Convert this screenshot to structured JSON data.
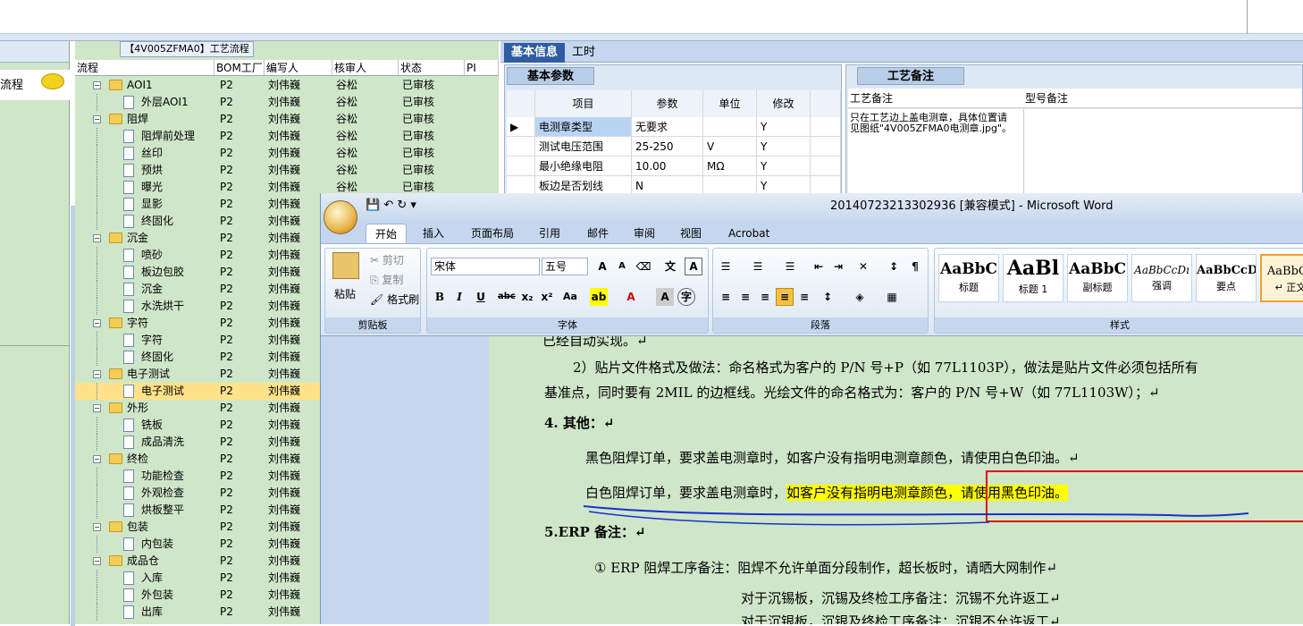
{
  "left_pane": {
    "item": "流程"
  },
  "tree": {
    "title": "【4V005ZFMA0】工艺流程",
    "headers": [
      "流程",
      "BOM工厂",
      "编写人",
      "核审人",
      "状态",
      "PI"
    ],
    "rows": [
      {
        "label": "AOI1",
        "level": 0,
        "folder": true,
        "bom": "P2",
        "writer": "刘伟巍",
        "reviewer": "谷松",
        "status": "已审核"
      },
      {
        "label": "外层AOI1",
        "level": 1,
        "folder": false,
        "bom": "P2",
        "writer": "刘伟巍",
        "reviewer": "谷松",
        "status": "已审核"
      },
      {
        "label": "阻焊",
        "level": 0,
        "folder": true,
        "bom": "P2",
        "writer": "刘伟巍",
        "reviewer": "谷松",
        "status": "已审核"
      },
      {
        "label": "阻焊前处理",
        "level": 1,
        "folder": false,
        "bom": "P2",
        "writer": "刘伟巍",
        "reviewer": "谷松",
        "status": "已审核"
      },
      {
        "label": "丝印",
        "level": 1,
        "folder": false,
        "bom": "P2",
        "writer": "刘伟巍",
        "reviewer": "谷松",
        "status": "已审核"
      },
      {
        "label": "预烘",
        "level": 1,
        "folder": false,
        "bom": "P2",
        "writer": "刘伟巍",
        "reviewer": "谷松",
        "status": "已审核"
      },
      {
        "label": "曝光",
        "level": 1,
        "folder": false,
        "bom": "P2",
        "writer": "刘伟巍",
        "reviewer": "谷松",
        "status": "已审核"
      },
      {
        "label": "显影",
        "level": 1,
        "folder": false,
        "bom": "P2",
        "writer": "刘伟巍",
        "reviewer": "",
        "status": ""
      },
      {
        "label": "终固化",
        "level": 1,
        "folder": false,
        "bom": "P2",
        "writer": "刘伟巍",
        "reviewer": "",
        "status": ""
      },
      {
        "label": "沉金",
        "level": 0,
        "folder": true,
        "bom": "P2",
        "writer": "刘伟巍",
        "reviewer": "",
        "status": ""
      },
      {
        "label": "喷砂",
        "level": 1,
        "folder": false,
        "bom": "P2",
        "writer": "刘伟巍",
        "reviewer": "",
        "status": ""
      },
      {
        "label": "板边包胶",
        "level": 1,
        "folder": false,
        "bom": "P2",
        "writer": "刘伟巍",
        "reviewer": "",
        "status": ""
      },
      {
        "label": "沉金",
        "level": 1,
        "folder": false,
        "bom": "P2",
        "writer": "刘伟巍",
        "reviewer": "",
        "status": ""
      },
      {
        "label": "水洗烘干",
        "level": 1,
        "folder": false,
        "bom": "P2",
        "writer": "刘伟巍",
        "reviewer": "",
        "status": ""
      },
      {
        "label": "字符",
        "level": 0,
        "folder": true,
        "bom": "P2",
        "writer": "刘伟巍",
        "reviewer": "",
        "status": ""
      },
      {
        "label": "字符",
        "level": 1,
        "folder": false,
        "bom": "P2",
        "writer": "刘伟巍",
        "reviewer": "",
        "status": ""
      },
      {
        "label": "终固化",
        "level": 1,
        "folder": false,
        "bom": "P2",
        "writer": "刘伟巍",
        "reviewer": "",
        "status": ""
      },
      {
        "label": "电子测试",
        "level": 0,
        "folder": true,
        "bom": "P2",
        "writer": "刘伟巍",
        "reviewer": "",
        "status": ""
      },
      {
        "label": "电子测试",
        "level": 1,
        "folder": false,
        "bom": "P2",
        "writer": "刘伟巍",
        "reviewer": "",
        "status": "",
        "selected": true
      },
      {
        "label": "外形",
        "level": 0,
        "folder": true,
        "bom": "P2",
        "writer": "刘伟巍",
        "reviewer": "",
        "status": ""
      },
      {
        "label": "铣板",
        "level": 1,
        "folder": false,
        "bom": "P2",
        "writer": "刘伟巍",
        "reviewer": "",
        "status": ""
      },
      {
        "label": "成品清洗",
        "level": 1,
        "folder": false,
        "bom": "P2",
        "writer": "刘伟巍",
        "reviewer": "",
        "status": ""
      },
      {
        "label": "终检",
        "level": 0,
        "folder": true,
        "bom": "P2",
        "writer": "刘伟巍",
        "reviewer": "",
        "status": ""
      },
      {
        "label": "功能检查",
        "level": 1,
        "folder": false,
        "bom": "P2",
        "writer": "刘伟巍",
        "reviewer": "",
        "status": ""
      },
      {
        "label": "外观检查",
        "level": 1,
        "folder": false,
        "bom": "P2",
        "writer": "刘伟巍",
        "reviewer": "",
        "status": ""
      },
      {
        "label": "烘板整平",
        "level": 1,
        "folder": false,
        "bom": "P2",
        "writer": "刘伟巍",
        "reviewer": "",
        "status": ""
      },
      {
        "label": "包装",
        "level": 0,
        "folder": true,
        "bom": "P2",
        "writer": "刘伟巍",
        "reviewer": "",
        "status": ""
      },
      {
        "label": "内包装",
        "level": 1,
        "folder": false,
        "bom": "P2",
        "writer": "刘伟巍",
        "reviewer": "",
        "status": ""
      },
      {
        "label": "成品仓",
        "level": 0,
        "folder": true,
        "bom": "P2",
        "writer": "刘伟巍",
        "reviewer": "",
        "status": ""
      },
      {
        "label": "入库",
        "level": 1,
        "folder": false,
        "bom": "P2",
        "writer": "刘伟巍",
        "reviewer": "",
        "status": ""
      },
      {
        "label": "外包装",
        "level": 1,
        "folder": false,
        "bom": "P2",
        "writer": "刘伟巍",
        "reviewer": "",
        "status": ""
      },
      {
        "label": "出库",
        "level": 1,
        "folder": false,
        "bom": "P2",
        "writer": "刘伟巍",
        "reviewer": "",
        "status": ""
      }
    ]
  },
  "right_tabs": [
    "基本信息",
    "工时"
  ],
  "basic_params": {
    "title": "基本参数",
    "headers": [
      "项目",
      "参数",
      "单位",
      "修改"
    ],
    "rows": [
      {
        "item": "电测章类型",
        "param": "无要求",
        "unit": "",
        "edit": "Y",
        "current": true
      },
      {
        "item": "测试电压范围",
        "param": "25-250",
        "unit": "V",
        "edit": "Y"
      },
      {
        "item": "最小绝缘电阻",
        "param": "10.00",
        "unit": "MΩ",
        "edit": "Y"
      },
      {
        "item": "板边是否划线",
        "param": "N",
        "unit": "",
        "edit": "Y"
      }
    ]
  },
  "craft_note": {
    "title": "工艺备注",
    "col1": "工艺备注",
    "col2": "型号备注",
    "text": "只在工艺边上盖电测章，具体位置请见图纸\"4V005ZFMA0电测章.jpg\"。"
  },
  "word": {
    "title": "20140723213302936 [兼容模式] - Microsoft Word",
    "tabs": [
      "开始",
      "插入",
      "页面布局",
      "引用",
      "邮件",
      "审阅",
      "视图",
      "Acrobat"
    ],
    "clipboard": {
      "paste": "粘贴",
      "cut": "剪切",
      "copy": "复制",
      "format_painter": "格式刷",
      "label": "剪贴板"
    },
    "font": {
      "name": "宋体",
      "size": "五号",
      "label": "字体"
    },
    "paragraph_label": "段落",
    "styles": [
      {
        "preview": "AaBbC",
        "name": "标题"
      },
      {
        "preview": "AaBl",
        "name": "标题 1"
      },
      {
        "preview": "AaBbC",
        "name": "副标题"
      },
      {
        "preview": "AaBbCcDı",
        "name": "强调"
      },
      {
        "preview": "AaBbCcD",
        "name": "要点"
      },
      {
        "preview": "AaBbCc",
        "name": "↵ 正文"
      }
    ],
    "styles_label": "样式",
    "doc": {
      "line0": "已经自动实现。↵",
      "line1": "2）贴片文件格式及做法：命名格式为客户的 P/N 号+P（如 77L1103P），做法是贴片文件必须包括所有",
      "line2": "基准点，同时要有 2MIL 的边框线。光绘文件的命名格式为：客户的  P/N 号+W（如 77L1103W）；↵",
      "line3": "4. 其他：↵",
      "line4": "黑色阻焊订单，要求盖电测章时，如客户没有指明电测章颜色，请使用白色印油。↵",
      "line5a": "白色阻焊订单，要求盖电测章时，",
      "line5b": "如客户没有指明电测章颜色，请使用黑色印油。",
      "line6": "5.ERP 备注：↵",
      "line7": "① ERP 阻焊工序备注：阻焊不允许单面分段制作，超长板时，请晒大网制作↵",
      "line8": "对于沉锡板，沉锡及终检工序备注：沉锡不允许返工↵",
      "line9": "对于沉银板，沉银及终检工序备注：沉银不允许返工↵"
    }
  }
}
